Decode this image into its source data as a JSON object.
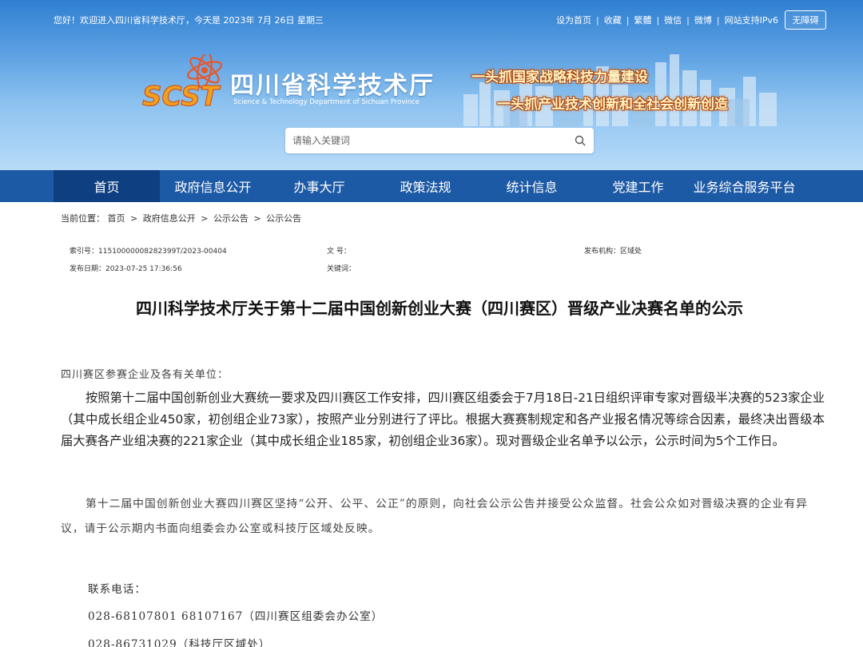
{
  "topbar": {
    "welcome": "您好！欢迎进入四川省科学技术厅，今天是  2023年 7月 26日  星期三",
    "links": [
      "设为首页",
      "收藏",
      "繁體",
      "微信",
      "微博",
      "网站支持IPv6"
    ],
    "accessibility": "无障碍"
  },
  "logo": {
    "mark_text": "SCST",
    "title": "四川省科学技术厅",
    "subtitle": "Science & Technology Department of Sichuan Province"
  },
  "banner": {
    "slogan_1": "一头抓国家战略科技力量建设",
    "slogan_2": "一头抓产业技术创新和全社会创新创造"
  },
  "search": {
    "placeholder": "请输入关键词"
  },
  "nav": {
    "items": [
      {
        "label": "首页"
      },
      {
        "label": "政府信息公开"
      },
      {
        "label": "办事大厅"
      },
      {
        "label": "政策法规"
      },
      {
        "label": "统计信息"
      },
      {
        "label": "党建工作"
      },
      {
        "label": "业务综合服务平台"
      }
    ]
  },
  "breadcrumb": {
    "label": "当前位置：",
    "items": [
      "首页",
      "政府信息公开",
      "公示公告",
      "公示公告"
    ],
    "separator": ">"
  },
  "meta": {
    "index_label": "索引号：",
    "index_value": "11510000008282399T/2023-00404",
    "doc_no_label": "文 号：",
    "doc_no_value": "",
    "issuer_label": "发布机构：",
    "issuer_value": "区域处",
    "date_label": "发布日期：",
    "date_value": "2023-07-25 17:36:56",
    "keywords_label": "关键词：",
    "keywords_value": ""
  },
  "article": {
    "title": "四川科学技术厅关于第十二届中国创新创业大赛（四川赛区）晋级产业决赛名单的公示",
    "salutation": "四川赛区参赛企业及各有关单位：",
    "paragraph_1": "按照第十二届中国创新创业大赛统一要求及四川赛区工作安排，四川赛区组委会于7月18日-21日组织评审专家对晋级半决赛的523家企业（其中成长组企业450家，初创组企业73家），按照产业分别进行了评比。根据大赛赛制规定和各产业报名情况等综合因素，最终决出晋级本届大赛各产业组决赛的221家企业（其中成长组企业185家，初创组企业36家）。现对晋级企业名单予以公示，公示时间为5个工作日。",
    "paragraph_2": "第十二届中国创新创业大赛四川赛区坚持“公开、公平、公正”的原则，向社会公示公告并接受公众监督。社会公众如对晋级决赛的企业有异议，请于公示期内书面向组委会办公室或科技厅区域处反映。",
    "contact_label": "联系电话：",
    "contact_1": "028-68107801    68107167（四川赛区组委会办公室）",
    "contact_2": "028-86731029（科技厅区域处）"
  },
  "colors": {
    "nav_bg": "#1d5aa6",
    "nav_active": "#0e3f80",
    "header_top": "#2f7fd1",
    "header_bottom": "#b7dbf8"
  }
}
